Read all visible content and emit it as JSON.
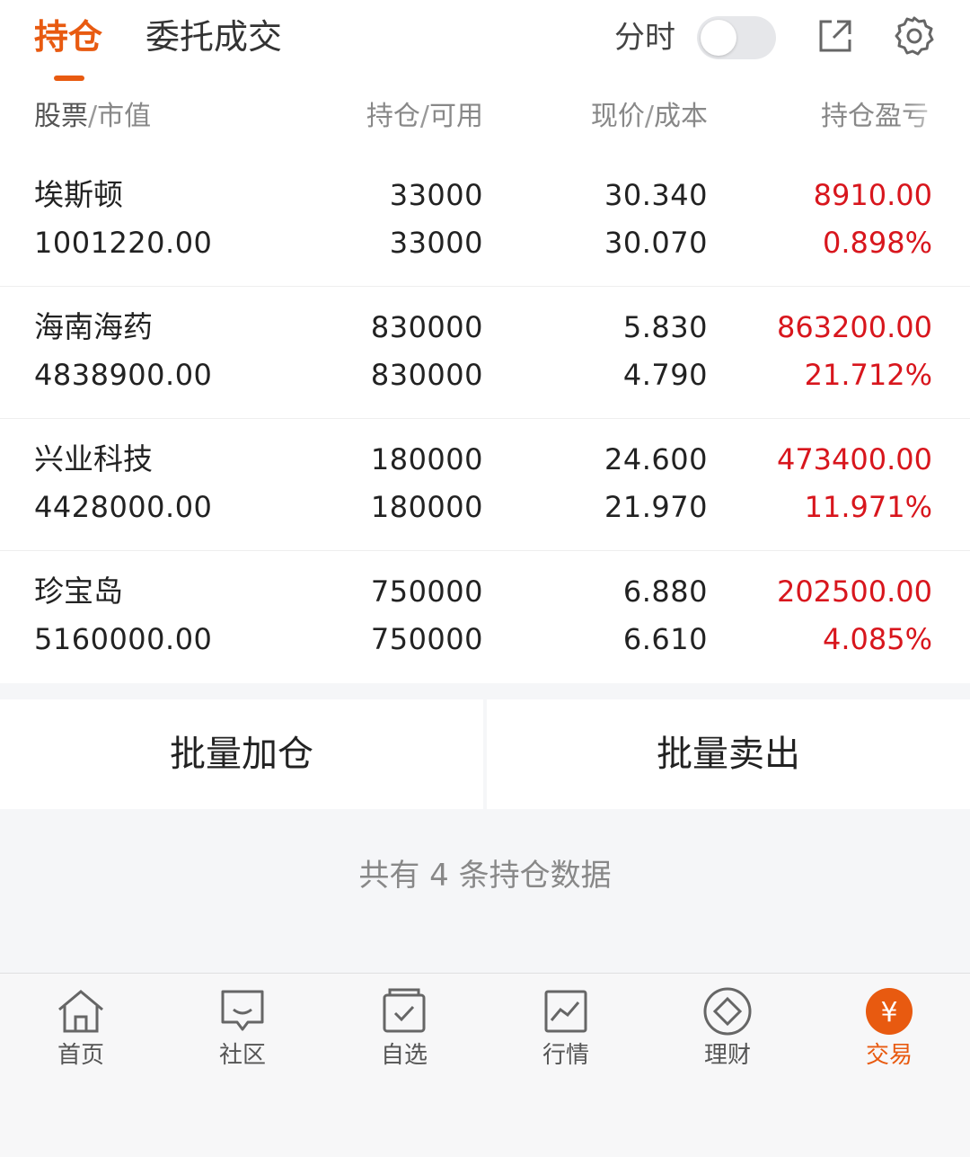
{
  "header": {
    "tab_holdings": "持仓",
    "tab_orders": "委托成交",
    "fenshi_label": "分时",
    "fenshi_on": false
  },
  "columns": {
    "col1_main": "股票",
    "col1_sub": "市值",
    "col2_main": "持仓",
    "col2_sub": "可用",
    "col3_main": "现价",
    "col3_sub": "成本",
    "col4_main": "持仓盈亏"
  },
  "positions": [
    {
      "name": "埃斯顿",
      "market_value": "1001220.00",
      "holding": "33000",
      "available": "33000",
      "price": "30.340",
      "cost": "30.070",
      "pnl": "8910.00",
      "pnl_pct": "0.898%"
    },
    {
      "name": "海南海药",
      "market_value": "4838900.00",
      "holding": "830000",
      "available": "830000",
      "price": "5.830",
      "cost": "4.790",
      "pnl": "863200.00",
      "pnl_pct": "21.712%"
    },
    {
      "name": "兴业科技",
      "market_value": "4428000.00",
      "holding": "180000",
      "available": "180000",
      "price": "24.600",
      "cost": "21.970",
      "pnl": "473400.00",
      "pnl_pct": "11.971%"
    },
    {
      "name": "珍宝岛",
      "market_value": "5160000.00",
      "holding": "750000",
      "available": "750000",
      "price": "6.880",
      "cost": "6.610",
      "pnl": "202500.00",
      "pnl_pct": "4.085%"
    }
  ],
  "actions": {
    "batch_add": "批量加仓",
    "batch_sell": "批量卖出"
  },
  "summary": "共有 4 条持仓数据",
  "nav": [
    {
      "label": "首页",
      "icon": "home-icon"
    },
    {
      "label": "社区",
      "icon": "chat-icon"
    },
    {
      "label": "自选",
      "icon": "watchlist-icon"
    },
    {
      "label": "行情",
      "icon": "chart-icon"
    },
    {
      "label": "理财",
      "icon": "diamond-icon"
    },
    {
      "label": "交易",
      "icon": "yuan-icon",
      "active": true
    }
  ],
  "colors": {
    "accent": "#e85a10",
    "profit": "#d8161d"
  }
}
